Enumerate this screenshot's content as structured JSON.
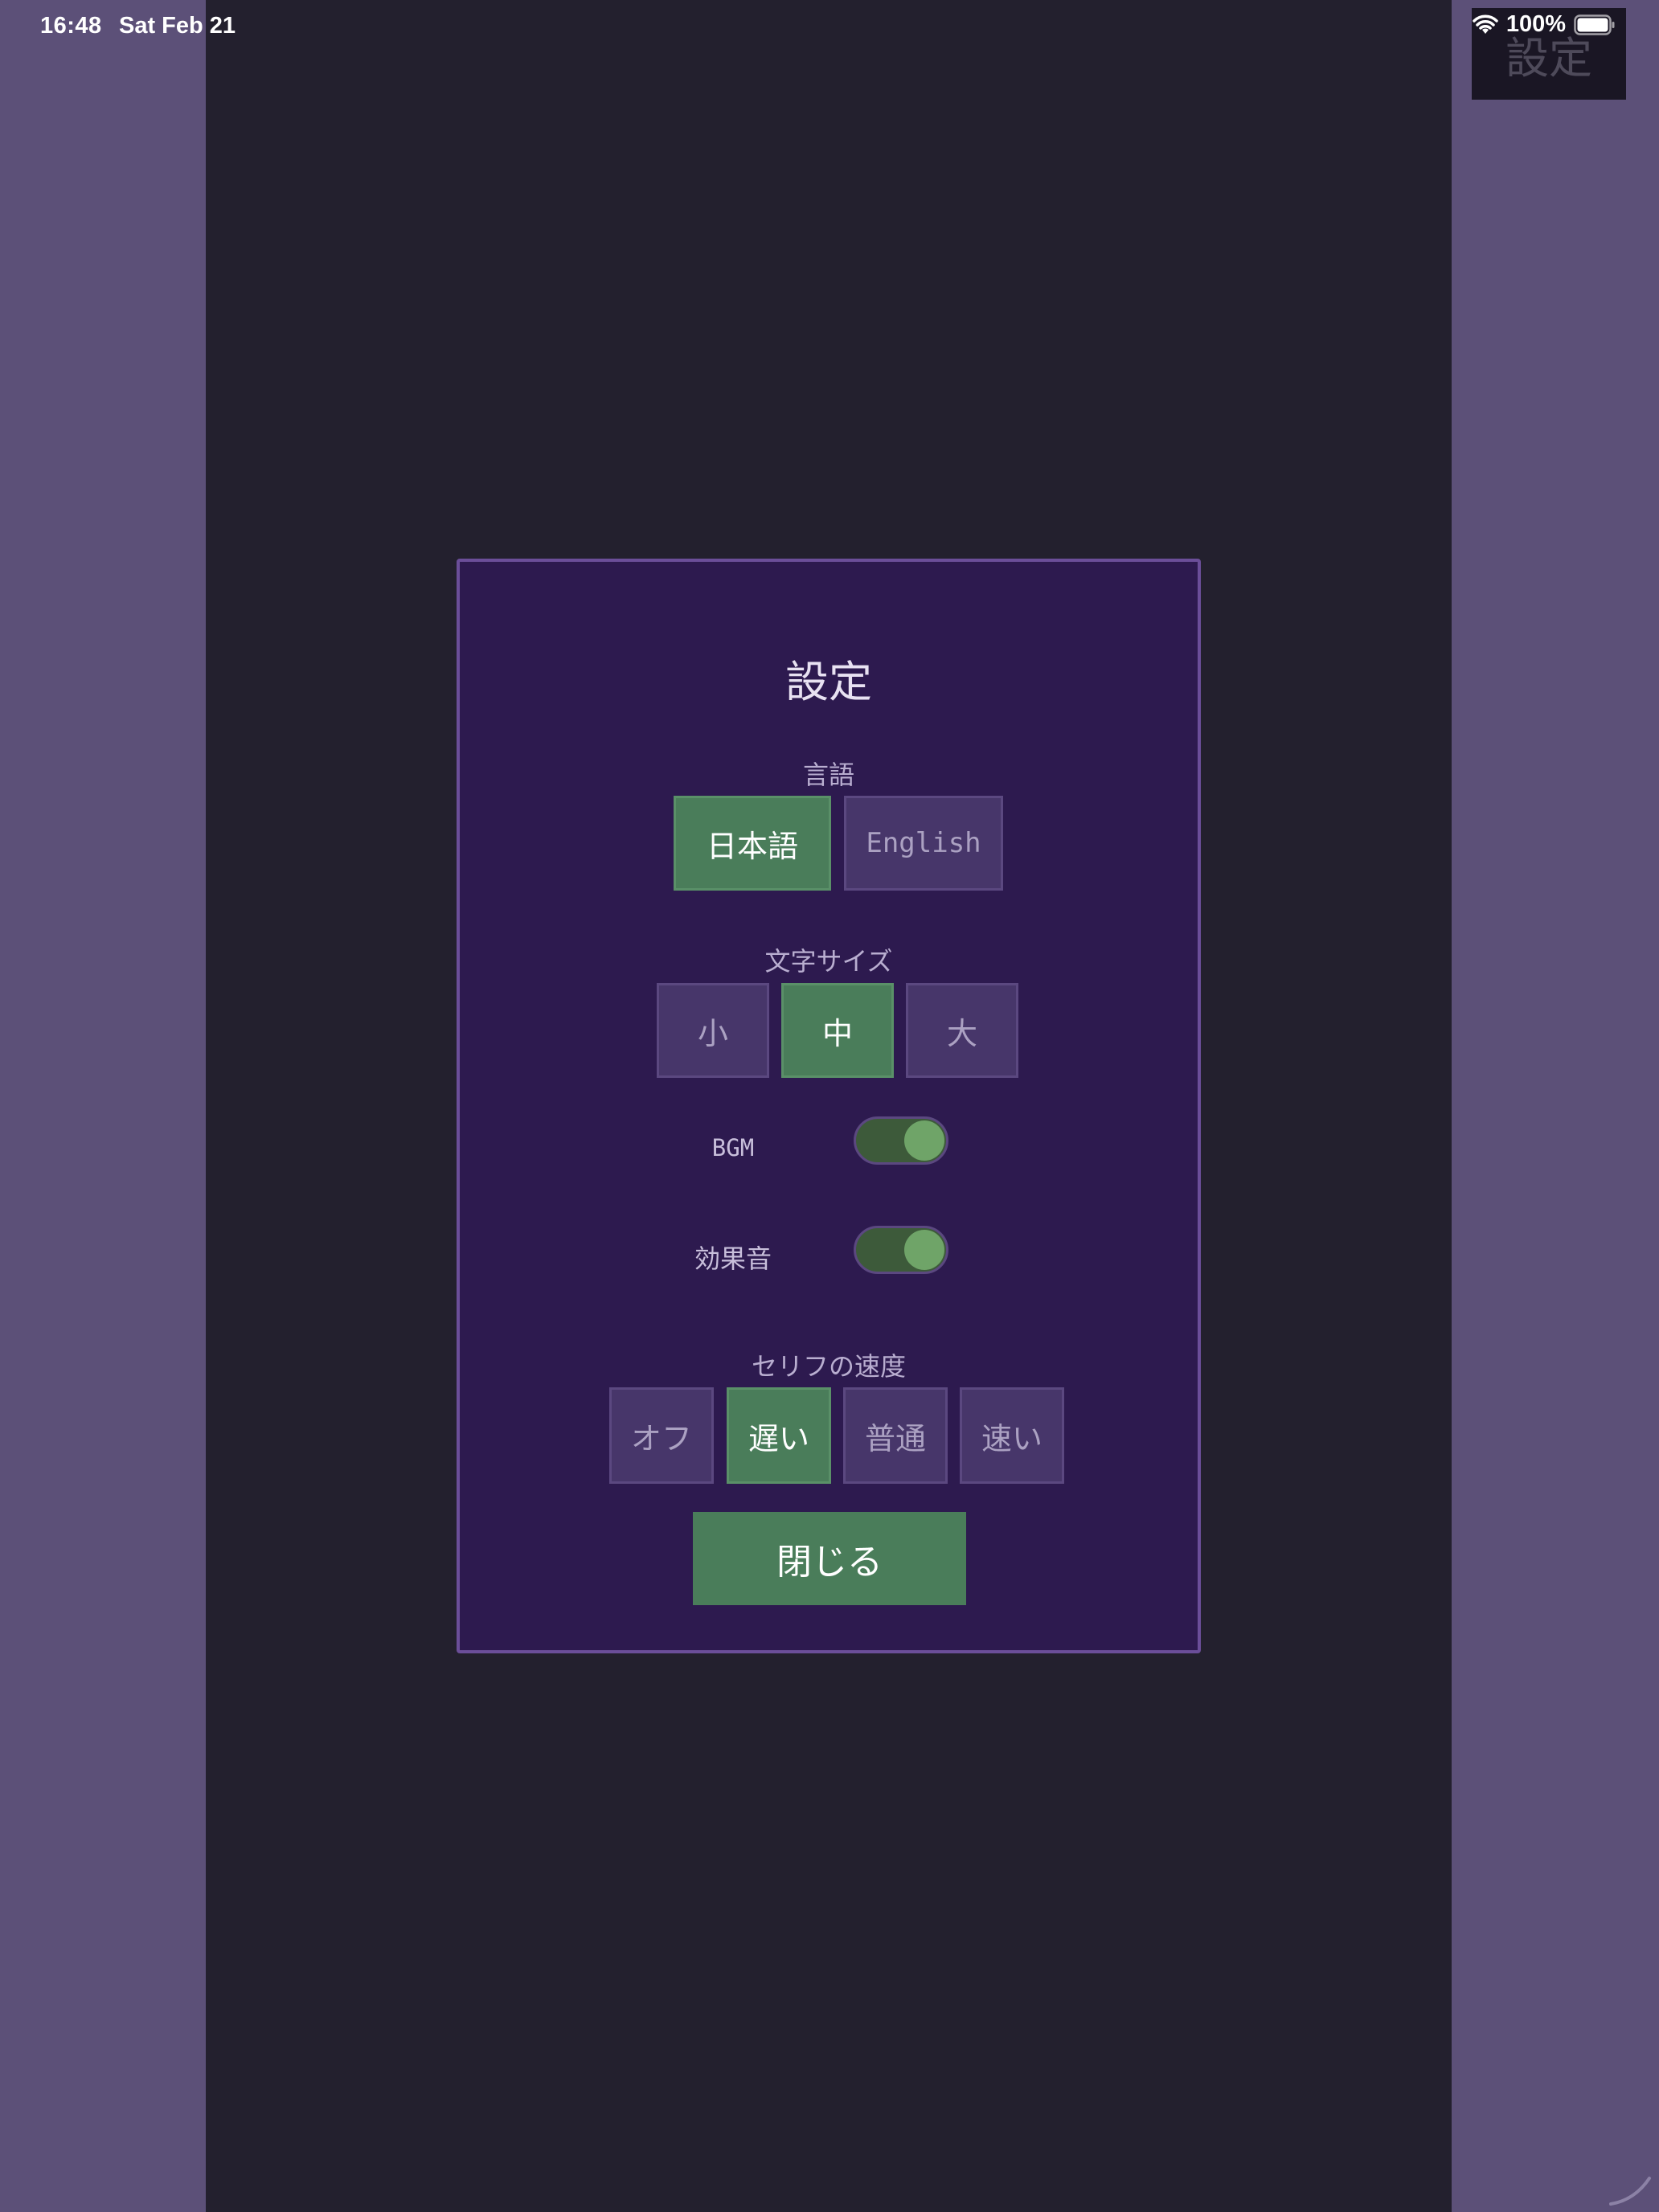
{
  "status_bar": {
    "time": "16:48",
    "date": "Sat Feb 21",
    "battery_percent": "100%",
    "wifi_icon": "wifi-icon",
    "battery_icon": "battery-icon"
  },
  "top_button": {
    "label": "設定"
  },
  "settings": {
    "title": "設定",
    "language": {
      "label": "言語",
      "options": [
        "日本語",
        "English"
      ],
      "selected": "日本語"
    },
    "text_size": {
      "label": "文字サイズ",
      "options": [
        "小",
        "中",
        "大"
      ],
      "selected": "中"
    },
    "bgm": {
      "label": "BGM",
      "on": true
    },
    "sfx": {
      "label": "効果音",
      "on": true
    },
    "dialogue_speed": {
      "label": "セリフの速度",
      "options": [
        "オフ",
        "遅い",
        "普通",
        "速い"
      ],
      "selected": "遅い"
    },
    "close_label": "閉じる"
  },
  "colors": {
    "outer_background": "#5c5078",
    "game_background": "#23202e",
    "modal_background": "#2d1a4f",
    "modal_border": "#6b4e99",
    "option_background": "#47366a",
    "selected_green": "#4a7d5a",
    "toggle_track": "#3d5a3a",
    "toggle_knob": "#6fa468"
  }
}
